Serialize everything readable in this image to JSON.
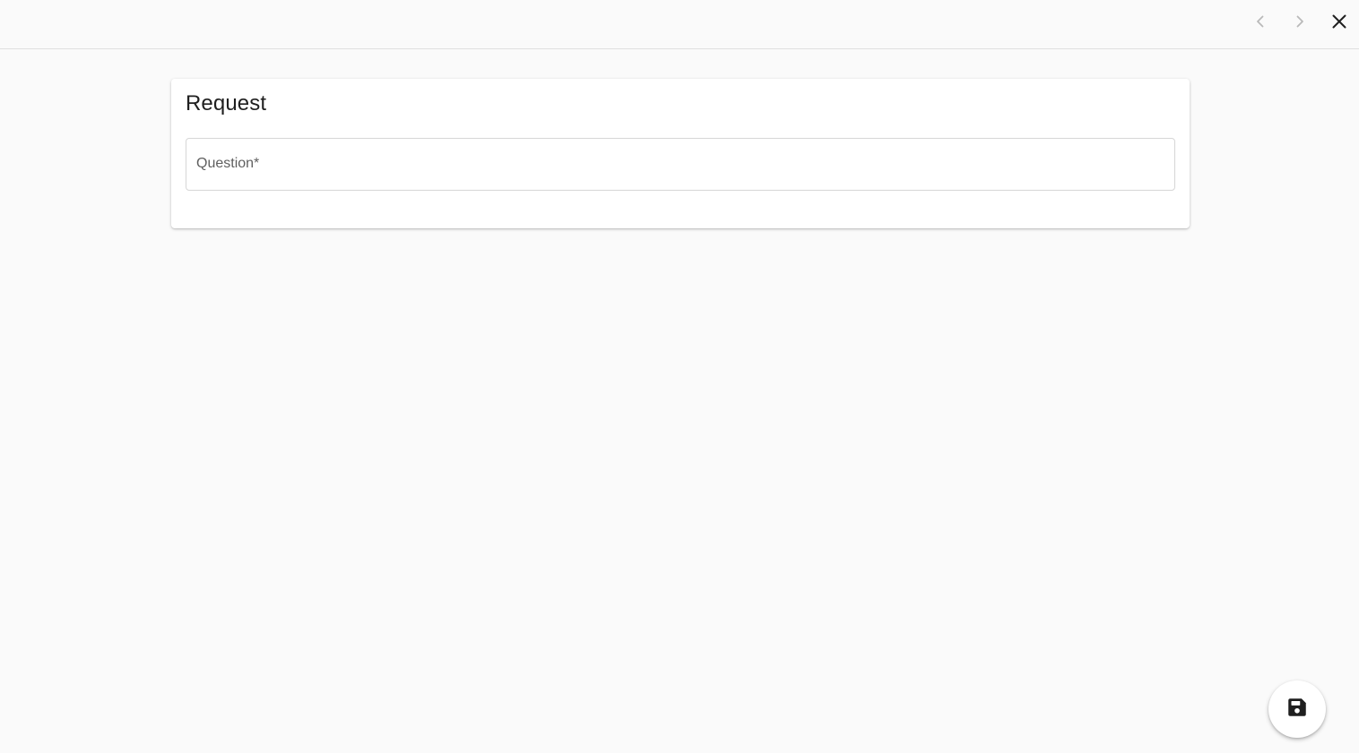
{
  "toolbar": {
    "prev_icon": "chevron-left-icon",
    "next_icon": "chevron-right-icon",
    "close_icon": "close-icon"
  },
  "form": {
    "title": "Request",
    "question": {
      "label": "Question*",
      "value": ""
    }
  },
  "fab": {
    "icon": "save-icon"
  },
  "colors": {
    "background": "#fafafa",
    "card": "#ffffff",
    "border": "#d6d6d6",
    "icon_dark": "#1f1f1f",
    "icon_disabled": "#b9b9b9"
  }
}
